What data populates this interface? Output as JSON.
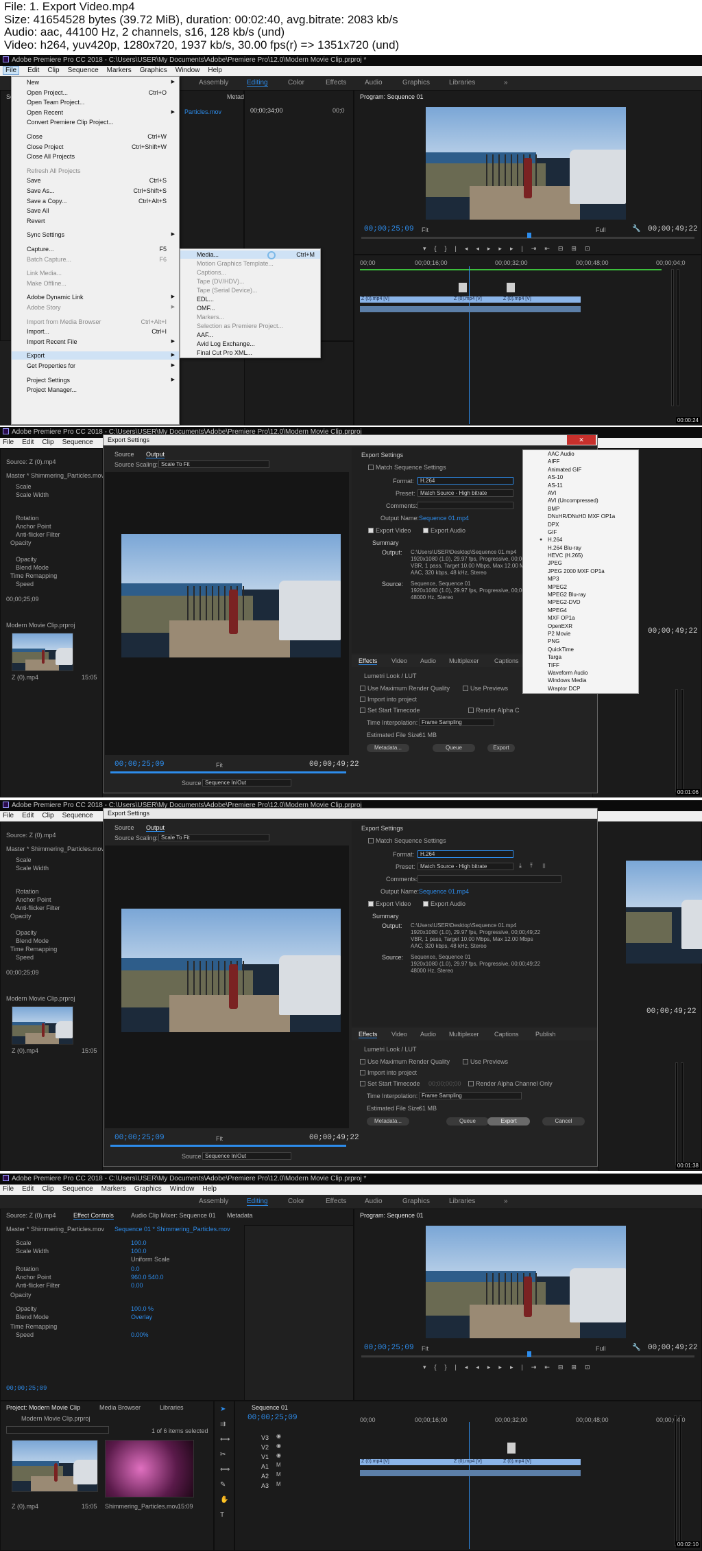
{
  "header": {
    "file": "File: 1. Export Video.mp4",
    "size": "Size: 41654528 bytes (39.72 MiB), duration: 00:02:40, avg.bitrate: 2083 kb/s",
    "audio": "Audio: aac, 44100 Hz, 2 channels, s16, 128 kb/s (und)",
    "video": "Video: h264, yuv420p, 1280x720, 1937 kb/s, 30.00 fps(r) => 1351x720 (und)"
  },
  "app": {
    "title": "Adobe Premiere Pro CC 2018 - C:\\Users\\USER\\My Documents\\Adobe\\Premiere Pro\\12.0\\Modern Movie Clip.prproj *",
    "title_short": "Adobe Premiere Pro CC 2018 - C:\\Users\\USER\\My Documents\\Adobe\\Premiere Pro\\12.0\\Modern Movie Clip.prproj",
    "menu": [
      "File",
      "Edit",
      "Clip",
      "Sequence",
      "Markers",
      "Graphics",
      "Window",
      "Help"
    ],
    "workspaces": [
      "Assembly",
      "Editing",
      "Color",
      "Effects",
      "Audio",
      "Graphics",
      "Libraries"
    ],
    "workspaces_short": [
      "Assembly",
      "Editing",
      "Color",
      "Effects",
      "Audio",
      "Graphics",
      "Libraries"
    ],
    "more": "»",
    "program_title": "Program: Sequence 01",
    "program_menu": "≡",
    "tc_current": "00;00;25;09",
    "tc_duration": "00;00;49;22",
    "fit": "Fit",
    "full": "Full",
    "tc_playhead": "00;00;34;00",
    "ruler": [
      "00;00",
      "00;00;16;00",
      "00;00;32;00",
      "00;00;48;00",
      "00;00;04;0"
    ],
    "clip_name": "Z (0).mp4 [V]",
    "clip_name2": "Z (0).mp4 [V]",
    "stamps": [
      "00:00:24",
      "00:01:06",
      "00:01:38",
      "00:02:10"
    ]
  },
  "file_menu": {
    "items": [
      {
        "label": "New",
        "shortcut": "",
        "arrow": true,
        "disabled": false
      },
      {
        "label": "Open Project...",
        "shortcut": "Ctrl+O",
        "arrow": false,
        "disabled": false
      },
      {
        "label": "Open Team Project...",
        "shortcut": "",
        "arrow": false,
        "disabled": false
      },
      {
        "label": "Open Recent",
        "shortcut": "",
        "arrow": true,
        "disabled": false
      },
      {
        "label": "Convert Premiere Clip Project...",
        "shortcut": "",
        "arrow": false,
        "disabled": false
      },
      {
        "label": "Close",
        "shortcut": "Ctrl+W",
        "arrow": false,
        "disabled": false
      },
      {
        "label": "Close Project",
        "shortcut": "Ctrl+Shift+W",
        "arrow": false,
        "disabled": false
      },
      {
        "label": "Close All Projects",
        "shortcut": "",
        "arrow": false,
        "disabled": false
      },
      {
        "label": "Refresh All Projects",
        "shortcut": "",
        "arrow": false,
        "disabled": true
      },
      {
        "label": "Save",
        "shortcut": "Ctrl+S",
        "arrow": false,
        "disabled": false
      },
      {
        "label": "Save As...",
        "shortcut": "Ctrl+Shift+S",
        "arrow": false,
        "disabled": false
      },
      {
        "label": "Save a Copy...",
        "shortcut": "Ctrl+Alt+S",
        "arrow": false,
        "disabled": false
      },
      {
        "label": "Save All",
        "shortcut": "",
        "arrow": false,
        "disabled": false
      },
      {
        "label": "Revert",
        "shortcut": "",
        "arrow": false,
        "disabled": false
      },
      {
        "label": "Sync Settings",
        "shortcut": "",
        "arrow": true,
        "disabled": false
      },
      {
        "label": "Capture...",
        "shortcut": "F5",
        "arrow": false,
        "disabled": false
      },
      {
        "label": "Batch Capture...",
        "shortcut": "F6",
        "arrow": false,
        "disabled": true
      },
      {
        "label": "Link Media...",
        "shortcut": "",
        "arrow": false,
        "disabled": true
      },
      {
        "label": "Make Offline...",
        "shortcut": "",
        "arrow": false,
        "disabled": true
      },
      {
        "label": "Adobe Dynamic Link",
        "shortcut": "",
        "arrow": true,
        "disabled": false
      },
      {
        "label": "Adobe Story",
        "shortcut": "",
        "arrow": true,
        "disabled": true
      },
      {
        "label": "Import from Media Browser",
        "shortcut": "Ctrl+Alt+I",
        "arrow": false,
        "disabled": true
      },
      {
        "label": "Import...",
        "shortcut": "Ctrl+I",
        "arrow": false,
        "disabled": false
      },
      {
        "label": "Import Recent File",
        "shortcut": "",
        "arrow": true,
        "disabled": false
      },
      {
        "label": "Export",
        "shortcut": "",
        "arrow": true,
        "disabled": false,
        "highlight": true
      },
      {
        "label": "Get Properties for",
        "shortcut": "",
        "arrow": true,
        "disabled": false
      },
      {
        "label": "Project Settings",
        "shortcut": "",
        "arrow": true,
        "disabled": false
      },
      {
        "label": "Project Manager...",
        "shortcut": "",
        "arrow": false,
        "disabled": false
      }
    ]
  },
  "export_menu": {
    "items": [
      {
        "label": "Media...",
        "shortcut": "Ctrl+M",
        "disabled": false,
        "highlight": true
      },
      {
        "label": "Motion Graphics Template...",
        "shortcut": "",
        "disabled": true
      },
      {
        "label": "Captions...",
        "shortcut": "",
        "disabled": true
      },
      {
        "label": "Tape (DV/HDV)...",
        "shortcut": "",
        "disabled": true
      },
      {
        "label": "Tape (Serial Device)...",
        "shortcut": "",
        "disabled": true
      },
      {
        "label": "EDL...",
        "shortcut": "",
        "disabled": false
      },
      {
        "label": "OMF...",
        "shortcut": "",
        "disabled": false
      },
      {
        "label": "Markers...",
        "shortcut": "",
        "disabled": true
      },
      {
        "label": "Selection as Premiere Project...",
        "shortcut": "",
        "disabled": true
      },
      {
        "label": "AAF...",
        "shortcut": "",
        "disabled": false
      },
      {
        "label": "Avid Log Exchange...",
        "shortcut": "",
        "disabled": false
      },
      {
        "label": "Final Cut Pro XML...",
        "shortcut": "",
        "disabled": false
      }
    ]
  },
  "frame1": {
    "source_tab": "Sou",
    "effect_tab": "Effect Controls",
    "metadata_tab": "Metadata",
    "audio_mixer": "Audio Clip Mixer: Sequence 01",
    "clip_ref": "Particles.mov",
    "tc": "00;00;34;00",
    "tc_end": "00;0",
    "mix_tab": "ce (0)",
    "proj_tab": "Proj"
  },
  "export_dialog": {
    "title": "Export Settings",
    "close": "✕",
    "tabs": [
      "Source",
      "Output"
    ],
    "source_scaling_label": "Source Scaling:",
    "source_scaling_value": "Scale To Fit",
    "export_settings_label": "Export Settings",
    "match_sequence": "Match Sequence Settings",
    "format_label": "Format:",
    "format_value": "H.264",
    "preset_label": "Preset:",
    "preset_value": "Match Source - High bitrate",
    "comments_label": "Comments:",
    "output_name_label": "Output Name:",
    "output_name_value": "Sequence 01.mp4",
    "export_video": "Export Video",
    "export_audio": "Export Audio",
    "summary_label": "Summary",
    "output_label": "Output:",
    "output_lines": [
      "C:\\Users\\USER\\Desktop\\Sequence 01.mp4",
      "1920x1080 (1.0), 29.97 fps, Progressive, 00;00;49;22",
      "VBR, 1 pass, Target 10.00 Mbps, Max 12.00 Mbps",
      "AAC, 320 kbps, 48 kHz, Stereo"
    ],
    "source_label": "Source:",
    "source_lines": [
      "Sequence, Sequence 01",
      "1920x1080 (1.0), 29.97 fps, Progressive, 00;00;49;22",
      "48000 Hz, Stereo"
    ],
    "bottom_tabs": [
      "Effects",
      "Video",
      "Audio",
      "Multiplexer",
      "Captions",
      "Publish"
    ],
    "lumetri": "Lumetri Look / LUT",
    "use_max_render": "Use Maximum Render Quality",
    "use_previews": "Use Previews",
    "import_into_project": "Import into project",
    "set_start_timecode": "Set Start Timecode",
    "start_tc_value": "00;00;00;00",
    "render_alpha": "Render Alpha Channel Only",
    "render_alpha_short": "Render Alpha C",
    "time_interp_label": "Time Interpolation:",
    "time_interp_value": "Frame Sampling",
    "file_size_label": "Estimated File Size:",
    "file_size_value": "61 MB",
    "metadata_btn": "Metadata...",
    "queue_btn": "Queue",
    "export_btn": "Export",
    "cancel_btn": "Cancel",
    "tc_left": "00;00;25;09",
    "tc_right": "00;00;49;22",
    "fit": "Fit",
    "source_range_label": "Source Range:",
    "source_range_value": "Sequence In/Out"
  },
  "format_list": {
    "items": [
      "AAC Audio",
      "AIFF",
      "Animated GIF",
      "AS-10",
      "AS-11",
      "AVI",
      "AVI (Uncompressed)",
      "BMP",
      "DNxHR/DNxHD MXF OP1a",
      "DPX",
      "GIF",
      "H.264",
      "H.264 Blu-ray",
      "HEVC (H.265)",
      "JPEG",
      "JPEG 2000 MXF OP1a",
      "MP3",
      "MPEG2",
      "MPEG2 Blu-ray",
      "MPEG2-DVD",
      "MPEG4",
      "MXF OP1a",
      "OpenEXR",
      "P2 Movie",
      "PNG",
      "QuickTime",
      "Targa",
      "TIFF",
      "Waveform Audio",
      "Windows Media",
      "Wraptor DCP"
    ],
    "selected": "H.264"
  },
  "bg_panel": {
    "source_label": "Source: Z (0).mp4",
    "effect_label": "Effect Con",
    "master": "Master * Shimmering_Particles.mov",
    "props": [
      "Scale",
      "Scale Width",
      "",
      "Rotation",
      "Anchor Point",
      "Anti-flicker Filter",
      "Opacity",
      "",
      "Opacity",
      "Blend Mode",
      "Time Remapping",
      "Speed"
    ],
    "tc": "00;00;25;09",
    "project": "Project: Modern Movie Clip",
    "project_file": "Modern Movie Clip.prproj",
    "item_name": "Z (0).mp4",
    "item_dur": "15:05",
    "right_tc": "00;00;49;22"
  },
  "frame4": {
    "source_tab": "Source: Z (0).mp4",
    "effect_tab": "Effect Controls",
    "mixer_tab": "Audio Clip Mixer: Sequence 01",
    "metadata_tab": "Metadata",
    "master": "Master * Shimmering_Particles.mov",
    "seq_ref": "Sequence 01 * Shimmering_Particles.mov",
    "props": [
      {
        "name": "Scale",
        "value": "100.0"
      },
      {
        "name": "Scale Width",
        "value": "100.0"
      },
      {
        "name": "Uniform Scale",
        "value": ""
      },
      {
        "name": "Rotation",
        "value": "0.0"
      },
      {
        "name": "Anchor Point",
        "value": "960.0    540.0"
      },
      {
        "name": "Anti-flicker Filter",
        "value": "0.00"
      },
      {
        "name": "Opacity",
        "value": ""
      },
      {
        "name": "Opacity",
        "value": "100.0 %"
      },
      {
        "name": "Blend Mode",
        "value": "Overlay"
      },
      {
        "name": "Time Remapping",
        "value": ""
      },
      {
        "name": "Speed",
        "value": "0.00%"
      }
    ],
    "tc_bottom": "00;00;25;09",
    "project_tab": "Project: Modern Movie Clip",
    "media_browser": "Media Browser",
    "libraries": "Libraries",
    "project_file": "Modern Movie Clip.prproj",
    "items_selected": "1 of 6 items selected",
    "thumb1_name": "Z (0).mp4",
    "thumb1_dur": "15:05",
    "thumb2_name": "Shimmering_Particles.mov",
    "thumb2_dur": "15:09",
    "sequence_tab": "Sequence 01",
    "seq_tc": "00;00;25;09",
    "tracks": [
      "V3",
      "V2",
      "V1",
      "A1",
      "A2",
      "A3"
    ],
    "track_v1_src": "V1"
  }
}
